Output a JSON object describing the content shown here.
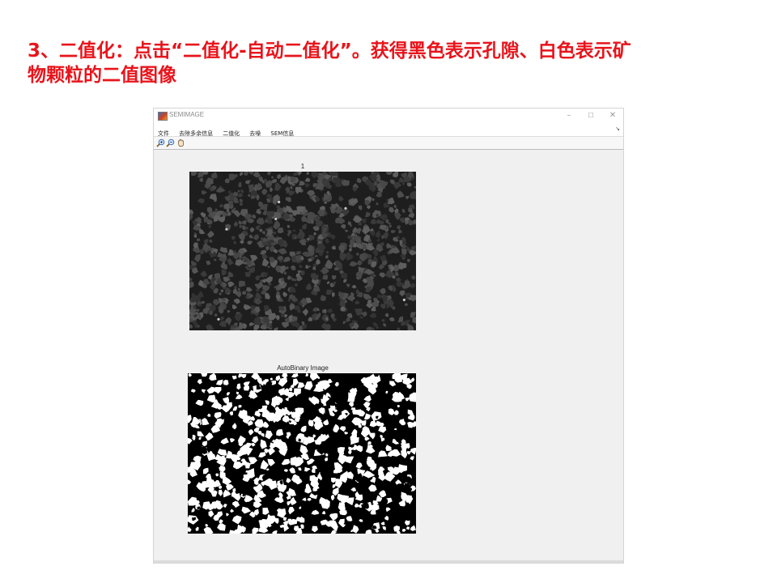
{
  "slide": {
    "heading_line1": "3、二值化：点击“二值化-自动二值化”。获得黑色表示孔隙、白色表示矿",
    "heading_line2": "物颗粒的二值图像",
    "heading_color": "#e8141b"
  },
  "window": {
    "title": "SEMIMAGE",
    "controls": {
      "minimize": "–",
      "maximize": "☐",
      "close": "✕"
    }
  },
  "menu": {
    "items": [
      "文件",
      "去除多余信息",
      "二值化",
      "去噪",
      "SEM信息"
    ],
    "dock_glyph": "↘"
  },
  "toolbar": {
    "tools": [
      "zoom-in-icon",
      "zoom-out-icon",
      "pan-hand-icon"
    ]
  },
  "axes": [
    {
      "title": "1",
      "content": "grayscale SEM image of rock grains (dark pores, gray mineral particles)"
    },
    {
      "title": "AutoBinary Image",
      "content": "binary image: black = pores, white = mineral particles"
    }
  ],
  "colors": {
    "window_bg": "#f0f0f0",
    "sem_dark": "#1e1e1e",
    "binary_black": "#000000",
    "binary_white": "#ffffff"
  }
}
